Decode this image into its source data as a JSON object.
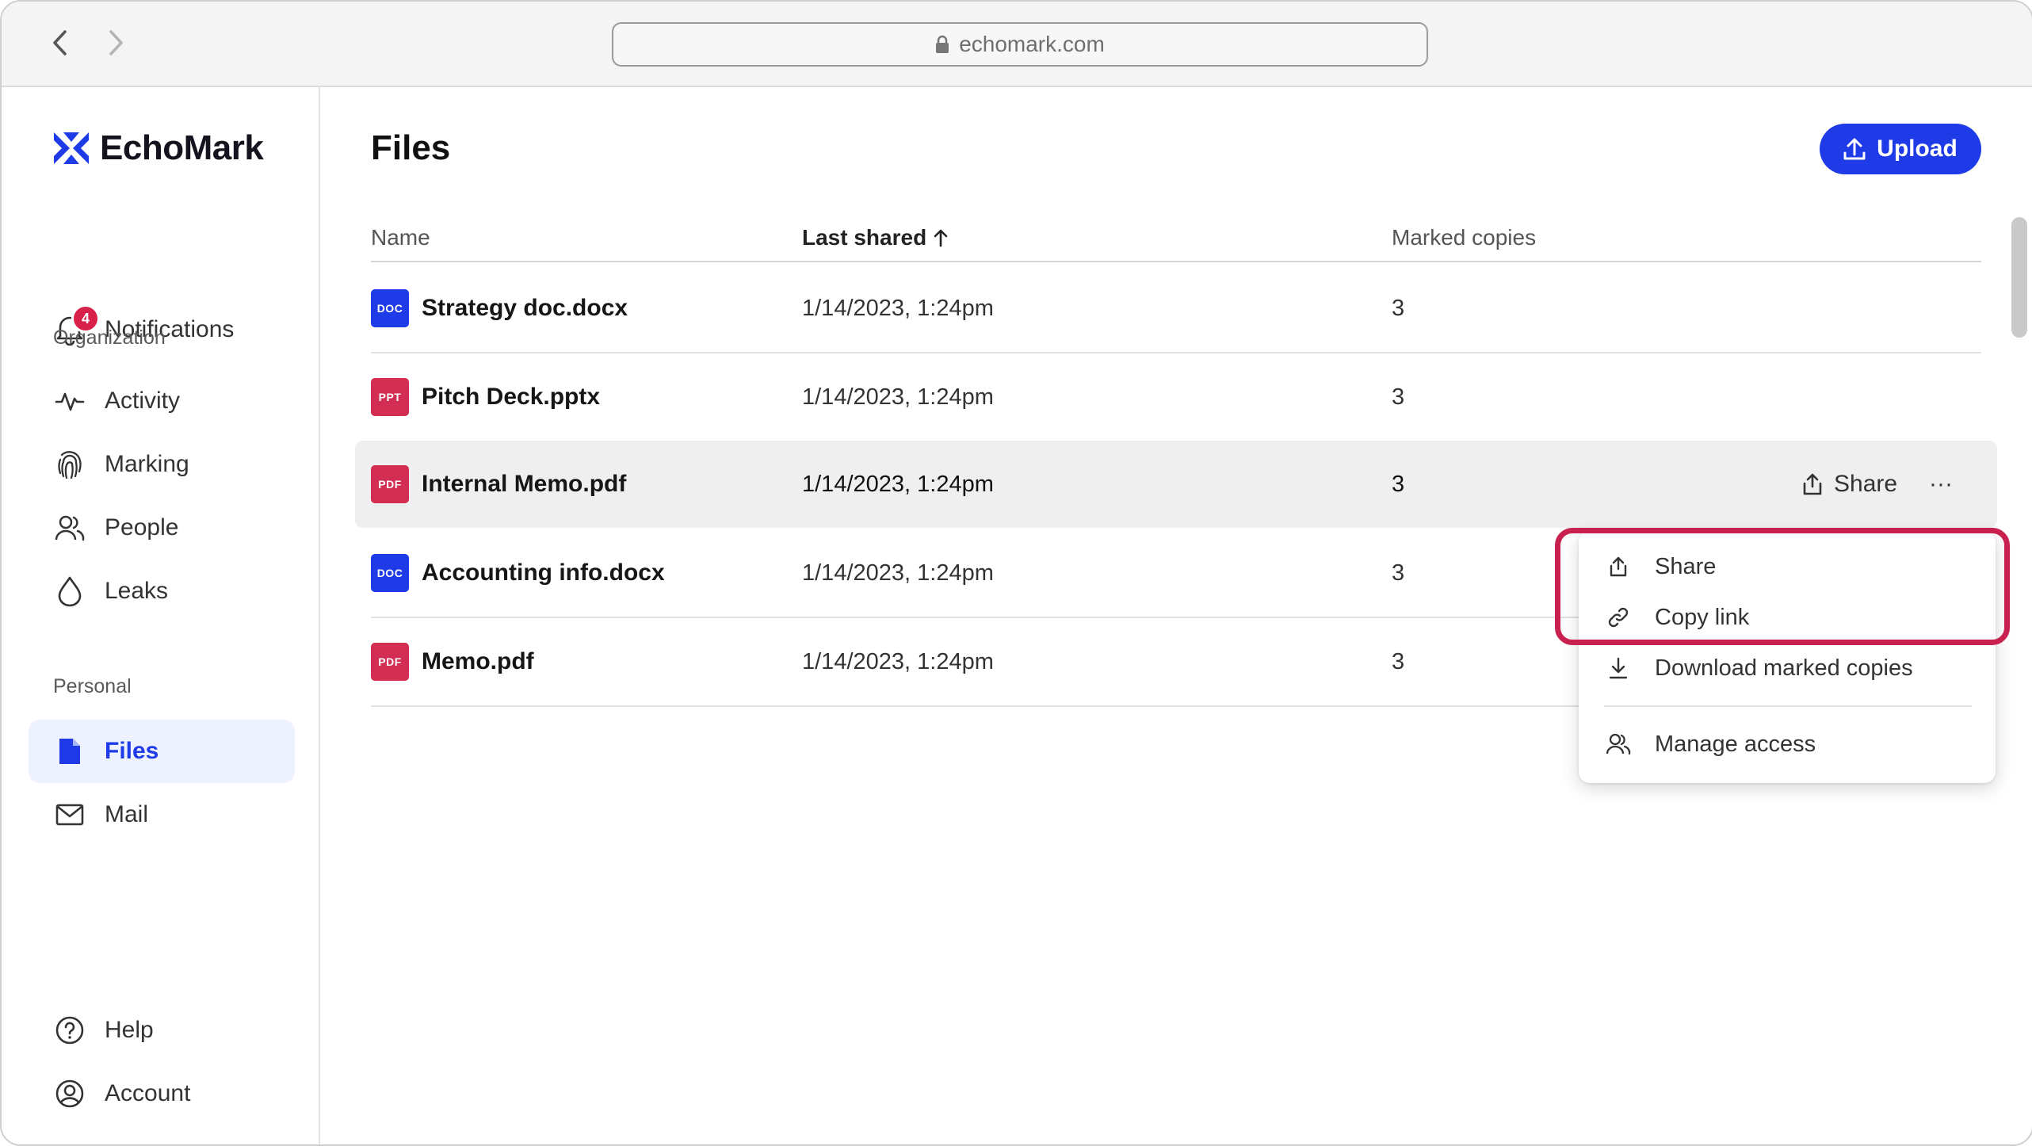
{
  "browser": {
    "url": "echomark.com"
  },
  "brand": {
    "name": "EchoMark",
    "accent": "#1f3be8",
    "alert": "#d22d52"
  },
  "sidebar": {
    "notifications": {
      "label": "Notifications",
      "count": "4"
    },
    "org_label": "Organization",
    "org_items": [
      {
        "label": "Activity",
        "icon": "activity-icon"
      },
      {
        "label": "Marking",
        "icon": "fingerprint-icon"
      },
      {
        "label": "People",
        "icon": "people-icon"
      },
      {
        "label": "Leaks",
        "icon": "droplet-icon"
      }
    ],
    "personal_label": "Personal",
    "personal_items": [
      {
        "label": "Files",
        "icon": "file-icon",
        "active": true
      },
      {
        "label": "Mail",
        "icon": "mail-icon"
      }
    ],
    "help": "Help",
    "account": "Account"
  },
  "main": {
    "title": "Files",
    "upload_label": "Upload",
    "columns": {
      "name": "Name",
      "last_shared": "Last shared",
      "marked_copies": "Marked copies"
    },
    "rows": [
      {
        "type": "DOC",
        "name": "Strategy doc.docx",
        "date": "1/14/2023, 1:24pm",
        "copies": "3"
      },
      {
        "type": "PPT",
        "name": "Pitch Deck.pptx",
        "date": "1/14/2023, 1:24pm",
        "copies": "3"
      },
      {
        "type": "PDF",
        "name": "Internal Memo.pdf",
        "date": "1/14/2023, 1:24pm",
        "copies": "3"
      },
      {
        "type": "DOC",
        "name": "Accounting info.docx",
        "date": "1/14/2023, 1:24pm",
        "copies": "3"
      },
      {
        "type": "PDF",
        "name": "Memo.pdf",
        "date": "1/14/2023, 1:24pm",
        "copies": "3"
      }
    ],
    "row_share_label": "Share",
    "row_more_label": "···"
  },
  "menu": {
    "items": [
      {
        "label": "Share",
        "icon": "share-icon"
      },
      {
        "label": "Copy link",
        "icon": "link-icon"
      },
      {
        "label": "Download marked copies",
        "icon": "download-icon"
      },
      {
        "label": "Manage access",
        "icon": "people-icon"
      }
    ]
  }
}
